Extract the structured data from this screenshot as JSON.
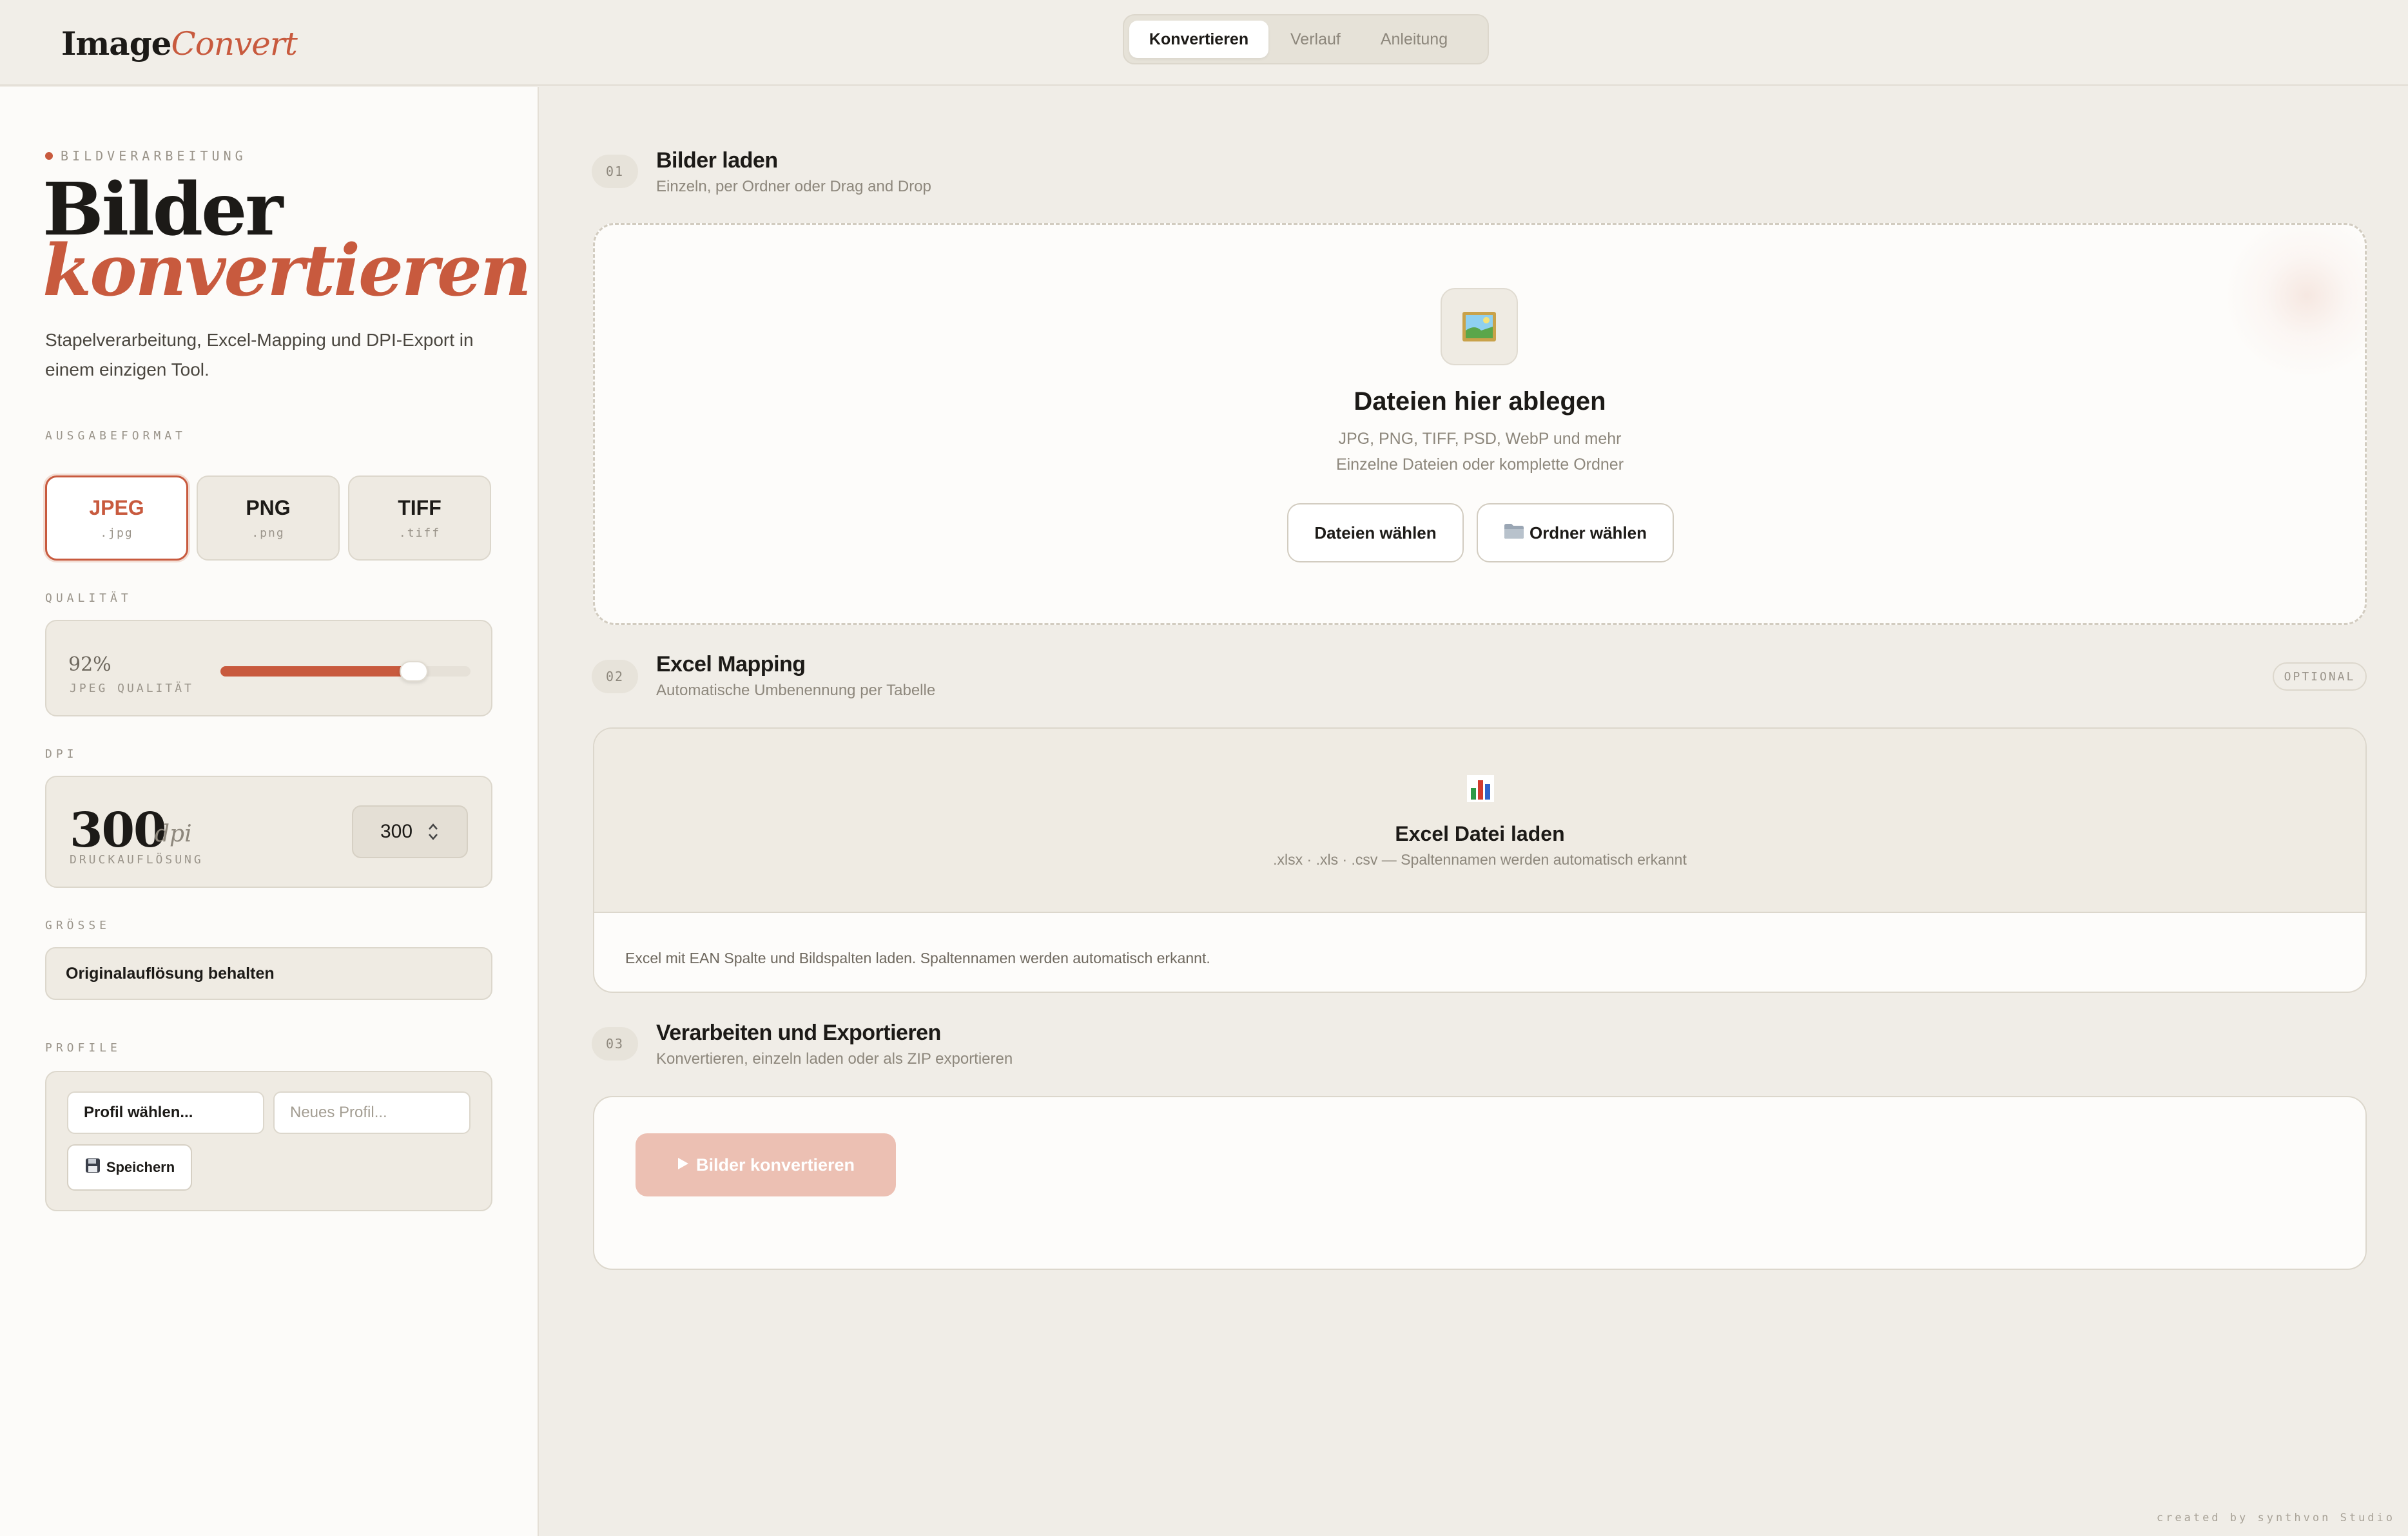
{
  "app": {
    "logo_part1": "Image",
    "logo_part2": "Convert",
    "accent_color": "#c85a3e"
  },
  "nav": {
    "tabs": [
      {
        "label": "Konvertieren",
        "active": true
      },
      {
        "label": "Verlauf",
        "active": false
      },
      {
        "label": "Anleitung",
        "active": false
      }
    ]
  },
  "sidebar": {
    "eyebrow": "BILDVERARBEITUNG",
    "hero_line1": "Bilder",
    "hero_line2": "konvertieren",
    "description": "Stapelverarbeitung, Excel-Mapping und DPI-Export in einem einzigen Tool.",
    "format_label": "AUSGABEFORMAT",
    "formats": [
      {
        "name": "JPEG",
        "ext": ".jpg",
        "selected": true
      },
      {
        "name": "PNG",
        "ext": ".png",
        "selected": false
      },
      {
        "name": "TIFF",
        "ext": ".tiff",
        "selected": false
      }
    ],
    "quality_label": "QUALITÄT",
    "quality_value": "92%",
    "quality_sub": "JPEG QUALITÄT",
    "quality_fraction": 0.92,
    "dpi_label": "DPI",
    "dpi_value": "300",
    "dpi_unit": "dpi",
    "dpi_sub": "DRUCKAUFLÖSUNG",
    "dpi_stepper_value": "300",
    "size_label": "GRÖSSE",
    "size_value": "Originalauflösung behalten",
    "profile_label": "PROFILE",
    "profile_select": "Profil wählen...",
    "profile_input_placeholder": "Neues Profil...",
    "profile_save": "Speichern",
    "icons": {
      "save": "floppy-disk-icon"
    }
  },
  "steps": {
    "step1": {
      "num": "01",
      "title": "Bilder laden",
      "subtitle": "Einzeln, per Ordner oder Drag and Drop",
      "drop_title": "Dateien hier ablegen",
      "drop_line1": "JPG, PNG, TIFF, PSD, WebP und mehr",
      "drop_line2": "Einzelne Dateien oder komplette Ordner",
      "btn_files": "Dateien wählen",
      "btn_folder": "Ordner wählen",
      "icons": {
        "drop": "picture-icon",
        "folder": "folder-icon"
      }
    },
    "step2": {
      "num": "02",
      "title": "Excel Mapping",
      "subtitle": "Automatische Umbenennung per Tabelle",
      "badge": "OPTIONAL",
      "load_title": "Excel Datei laden",
      "load_sub": ".xlsx · .xls · .csv — Spaltennamen werden automatisch erkannt",
      "note": "Excel mit EAN Spalte und Bildspalten laden. Spaltennamen werden automatisch erkannt.",
      "icons": {
        "excel": "bar-chart-icon"
      }
    },
    "step3": {
      "num": "03",
      "title": "Verarbeiten und Exportieren",
      "subtitle": "Konvertieren, einzeln laden oder als ZIP exportieren",
      "convert_label": "Bilder konvertieren",
      "icons": {
        "convert": "play-icon"
      }
    }
  },
  "footer": {
    "credit": "created by synthvon Studio"
  }
}
